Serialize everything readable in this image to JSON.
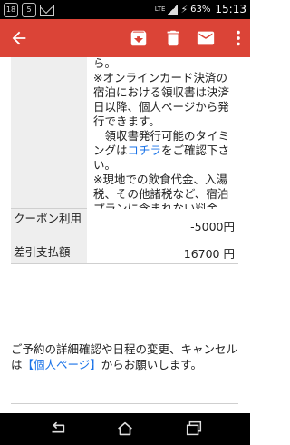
{
  "status_bar": {
    "notif_1": "18",
    "notif_2": "5",
    "network": "LTE",
    "battery": "63%",
    "time": "15:13"
  },
  "app_bar": {
    "color": "#db4437",
    "icons": [
      "back-arrow-icon",
      "archive-icon",
      "delete-icon",
      "mail-icon",
      "more-vertical-icon"
    ]
  },
  "receipt_block": {
    "lines": [
      "ら。",
      "※オンラインカード決済の宿泊における領収書は決済日以降、個人ページから発行できます。",
      "　領収書発行可能のタイミングは",
      "をご確認下さい。",
      "※現地での飲食代金、入湯税、その他諸税など、宿泊プランに含まれない料金　は、施設から指定がない場合、現地にて別途ご精算下さい。"
    ],
    "link_text": "コチラ"
  },
  "table": {
    "coupon_label": "クーポン利用",
    "coupon_value": "-5000円",
    "total_label": "差引支払額",
    "total_value": "16700 円"
  },
  "note": {
    "prefix": "ご予約の詳細確認や日程の変更、キャンセルは",
    "link": "【個人ページ】",
    "suffix": "からお願いします。"
  },
  "nav_bar": {
    "icons": [
      "nav-back-icon",
      "nav-home-icon",
      "nav-recents-icon"
    ]
  }
}
